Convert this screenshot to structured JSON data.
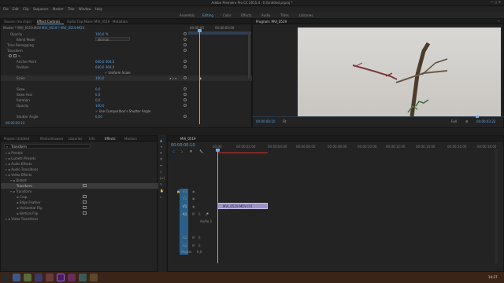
{
  "app": {
    "title": "Adobe Premiere Pro CC 2015.4 - E:\\Untitled.prproj *"
  },
  "menu": [
    "File",
    "Edit",
    "Clip",
    "Sequence",
    "Marker",
    "Title",
    "Window",
    "Help"
  ],
  "workspaces": [
    "Assembly",
    "Editing",
    "Color",
    "Effects",
    "Audio",
    "Titles",
    "Libraries"
  ],
  "source_panel": {
    "tabs": [
      "Source: (no clips)",
      "Effect Controls",
      "Audio Clip Mixer: MVI_0519",
      "Metadata"
    ],
    "header_master": "Master * MVI_0519.MOV",
    "header_seq": "MVI_0519 * MVI_0519.MOV",
    "timecodes": [
      "00:00:00",
      "00:00:05:00"
    ],
    "rows": [
      {
        "name": "Opacity",
        "value": "100,0 %"
      },
      {
        "name": "Blend Mode",
        "value": "Normal"
      },
      {
        "name": "Time Remapping",
        "value": ""
      },
      {
        "name": "Transform",
        "value": ""
      },
      {
        "name": "Anchor Point",
        "value": "640,0    360,0"
      },
      {
        "name": "Position",
        "value": "640,0    360,0"
      },
      {
        "name": "Uniform Scale",
        "value": "✓ Uniform Scale"
      },
      {
        "name": "Scale",
        "value": "100,0"
      },
      {
        "name": "Skew",
        "value": "0,0"
      },
      {
        "name": "Skew Axis",
        "value": "0,0"
      },
      {
        "name": "Rotation",
        "value": "0,0"
      },
      {
        "name": "Opacity",
        "value": "100,0"
      },
      {
        "name": "Use Composition's Shutter Angle",
        "value": "✓ Use Composition's Shutter Angle"
      },
      {
        "name": "Shutter Angle",
        "value": "0,00"
      }
    ],
    "footer_tc": "00:00:00:10"
  },
  "program_panel": {
    "title": "Program: MVI_0519",
    "tc_left": "00:00:00:10",
    "fit": "Fit",
    "full": "Full",
    "tc_right": "00:00:03:22"
  },
  "project_panel": {
    "tabs": [
      "Project: Untitled",
      "Media Browser",
      "Libraries",
      "Info",
      "Effects",
      "Markers"
    ],
    "search": "Transform",
    "tree": [
      "Presets",
      "Lumetri Presets",
      "Audio Effects",
      "Audio Transitions",
      "Video Effects",
      "Distort",
      "Transform",
      "Transform",
      "Crop",
      "Edge Feather",
      "Horizontal Flip",
      "Vertical Flip",
      "Video Transitions"
    ]
  },
  "timeline": {
    "title": "MVI_0519",
    "tc": "00:00:00:10",
    "ruler": [
      "00:00",
      "00:00:02:00",
      "00:00:04:00",
      "00:00:06:00",
      "00:00:08:00",
      "00:00:10:00",
      "00:00:12:00",
      "00:00:14:00",
      "00:00:16:00",
      "00:00:18:00"
    ],
    "tracks": [
      "V3",
      "V2",
      "V1",
      "A1",
      "A2",
      "A3",
      "Master"
    ],
    "clip_label": "MVI_0519.MOV [V]",
    "master_value": "0,0",
    "audio_label": "Audio 1"
  },
  "taskbar": {
    "time": "14:27"
  }
}
